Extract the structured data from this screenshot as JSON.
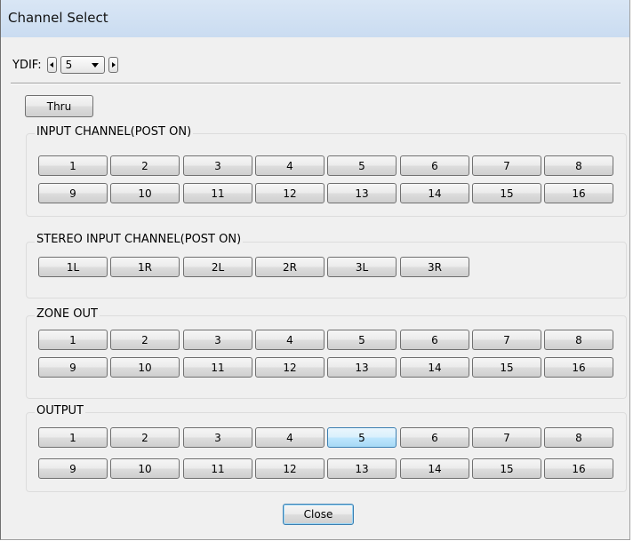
{
  "window": {
    "title": "Channel Select"
  },
  "ydif": {
    "label": "YDIF:",
    "value": "5"
  },
  "thru_label": "Thru",
  "groups": {
    "input": {
      "title": "INPUT CHANNEL(POST ON)",
      "row1": [
        "1",
        "2",
        "3",
        "4",
        "5",
        "6",
        "7",
        "8"
      ],
      "row2": [
        "9",
        "10",
        "11",
        "12",
        "13",
        "14",
        "15",
        "16"
      ]
    },
    "stereo": {
      "title": "STEREO INPUT CHANNEL(POST ON)",
      "row1": [
        "1L",
        "1R",
        "2L",
        "2R",
        "3L",
        "3R"
      ]
    },
    "zone": {
      "title": "ZONE OUT",
      "row1": [
        "1",
        "2",
        "3",
        "4",
        "5",
        "6",
        "7",
        "8"
      ],
      "row2": [
        "9",
        "10",
        "11",
        "12",
        "13",
        "14",
        "15",
        "16"
      ]
    },
    "output": {
      "title": "OUTPUT",
      "row1": [
        "1",
        "2",
        "3",
        "4",
        "5",
        "6",
        "7",
        "8"
      ],
      "row2": [
        "9",
        "10",
        "11",
        "12",
        "13",
        "14",
        "15",
        "16"
      ],
      "selected": "5"
    }
  },
  "close_label": "Close"
}
